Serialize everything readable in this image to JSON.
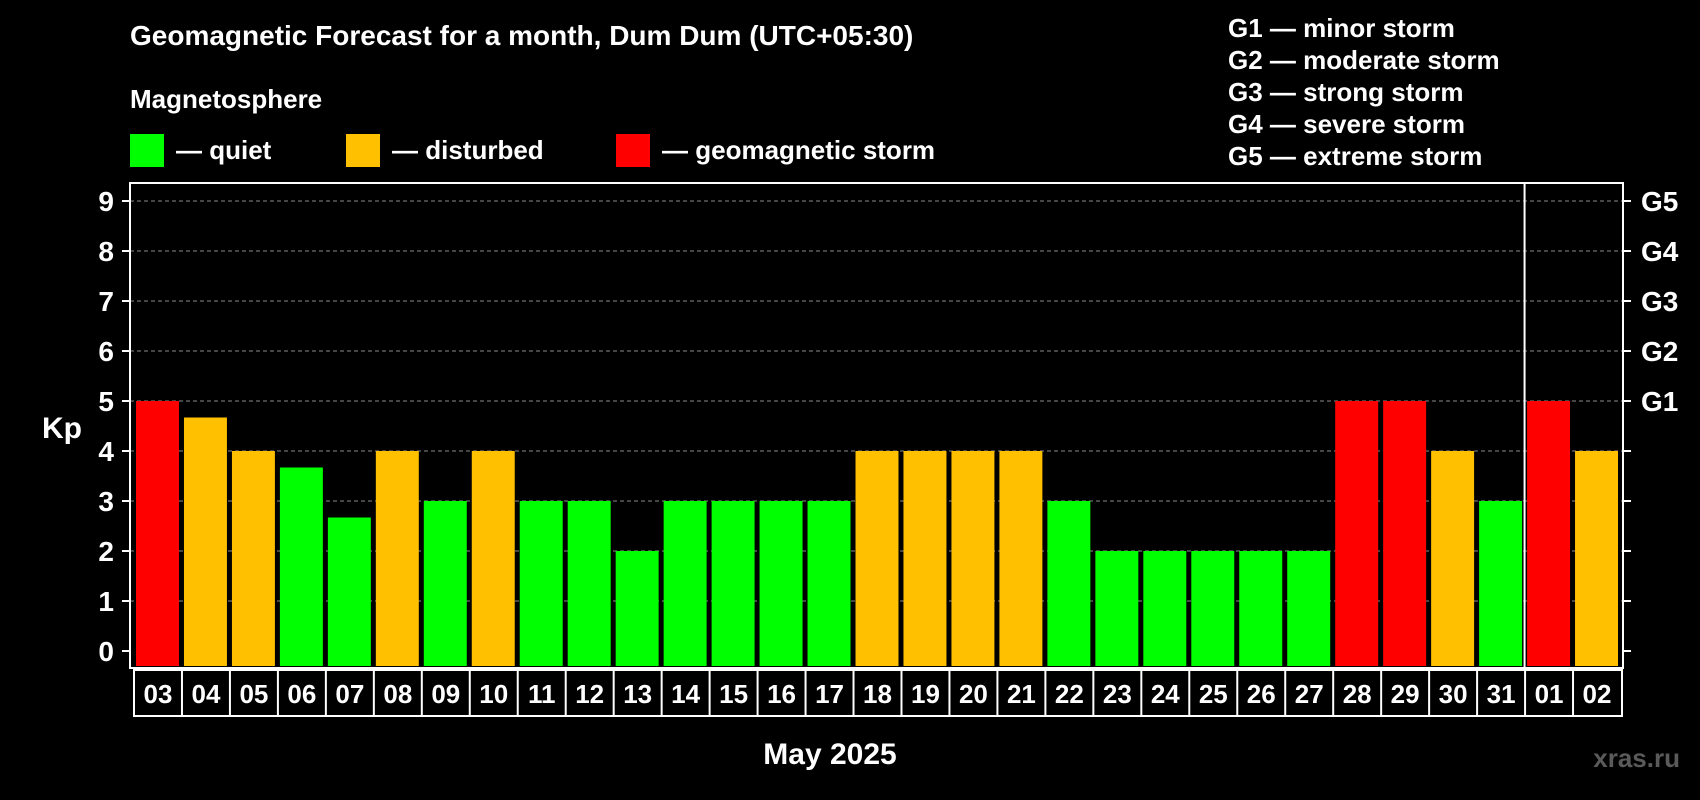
{
  "title": "Geomagnetic Forecast for a month, Dum Dum (UTC+05:30)",
  "magnetosphere_title": "Magnetosphere",
  "legend": [
    {
      "label": "— quiet",
      "color": "#00ff00"
    },
    {
      "label": "— disturbed",
      "color": "#ffc000"
    },
    {
      "label": "— geomagnetic storm",
      "color": "#ff0000"
    }
  ],
  "g_scale": [
    "G1 — minor storm",
    "G2 — moderate storm",
    "G3 — strong storm",
    "G4 — severe storm",
    "G5 — extreme storm"
  ],
  "watermark": "xras.ru",
  "colors": {
    "quiet": "#00ff00",
    "disturbed": "#ffc000",
    "storm": "#ff0000"
  },
  "chart_data": {
    "type": "bar",
    "ylabel": "Kp",
    "xlabel": "May 2025",
    "ylim": [
      0,
      9
    ],
    "yticks": [
      "0",
      "1",
      "2",
      "3",
      "4",
      "5",
      "6",
      "7",
      "8",
      "9"
    ],
    "right_ticks": [
      {
        "value": 5,
        "label": "G1"
      },
      {
        "value": 6,
        "label": "G2"
      },
      {
        "value": 7,
        "label": "G3"
      },
      {
        "value": 8,
        "label": "G4"
      },
      {
        "value": 9,
        "label": "G5"
      }
    ],
    "grid": "dashed horizontal",
    "month_separator_after_index": 28,
    "categories": [
      "03",
      "04",
      "05",
      "06",
      "07",
      "08",
      "09",
      "10",
      "11",
      "12",
      "13",
      "14",
      "15",
      "16",
      "17",
      "18",
      "19",
      "20",
      "21",
      "22",
      "23",
      "24",
      "25",
      "26",
      "27",
      "28",
      "29",
      "30",
      "31",
      "01",
      "02"
    ],
    "values": [
      5,
      4.67,
      4,
      3.67,
      2.67,
      4,
      3,
      4,
      3,
      3,
      2,
      3,
      3,
      3,
      3,
      4,
      4,
      4,
      4,
      3,
      2,
      2,
      2,
      2,
      2,
      5,
      5,
      4,
      3,
      5,
      4
    ],
    "levels": [
      "storm",
      "disturbed",
      "disturbed",
      "quiet",
      "quiet",
      "disturbed",
      "quiet",
      "disturbed",
      "quiet",
      "quiet",
      "quiet",
      "quiet",
      "quiet",
      "quiet",
      "quiet",
      "disturbed",
      "disturbed",
      "disturbed",
      "disturbed",
      "quiet",
      "quiet",
      "quiet",
      "quiet",
      "quiet",
      "quiet",
      "storm",
      "storm",
      "disturbed",
      "quiet",
      "storm",
      "disturbed"
    ]
  }
}
